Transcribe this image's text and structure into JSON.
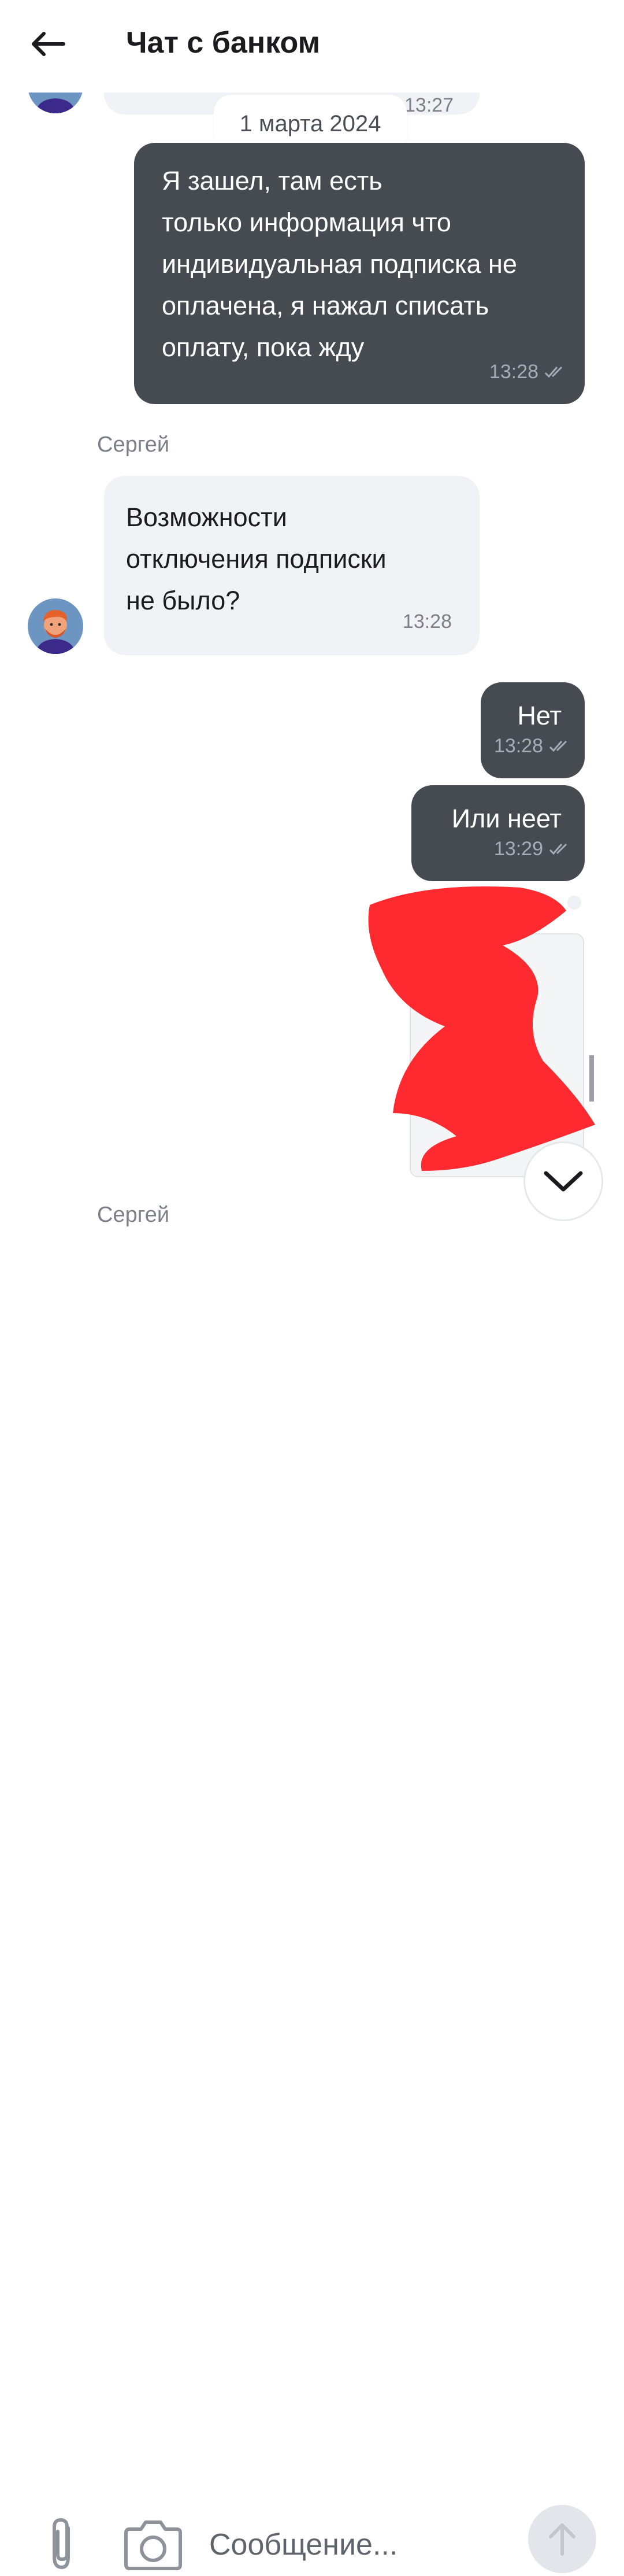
{
  "header": {
    "title": "Чат с банком"
  },
  "top_partial": {
    "time": "13:27"
  },
  "date_separator": "1 марта 2024",
  "messages": [
    {
      "direction": "out",
      "lines": [
        "Я зашел, там есть",
        "только информация что",
        "индивидуальная подписка не",
        "оплачена, я нажал списать",
        "оплату, пока жду"
      ],
      "time": "13:28",
      "status": "read"
    },
    {
      "direction": "in",
      "sender": "Сергей",
      "lines": [
        "Возможности",
        "отключения подписки",
        "не было?"
      ],
      "time": "13:28"
    },
    {
      "direction": "out",
      "lines": [
        "Нет"
      ],
      "time": "13:28",
      "status": "read"
    },
    {
      "direction": "out",
      "lines": [
        "Или неет"
      ],
      "time": "13:29",
      "status": "read"
    },
    {
      "direction": "out",
      "type": "image-redacted"
    },
    {
      "direction": "in",
      "sender": "Сергей"
    }
  ],
  "composer": {
    "placeholder": "Сообщение..."
  },
  "colors": {
    "outgoing_bubble": "#464b52",
    "incoming_bubble": "#f1f2f6",
    "redaction": "#ff2a2f"
  },
  "icons": [
    "back-arrow-icon",
    "double-check-icon",
    "chevron-down-icon",
    "paperclip-icon",
    "camera-icon",
    "arrow-up-icon"
  ]
}
